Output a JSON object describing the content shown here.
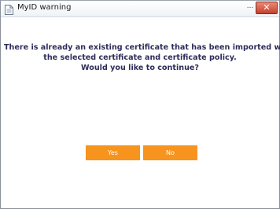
{
  "window": {
    "title": "MyID warning",
    "icon": "document-icon",
    "minimize_label": "...",
    "close_label": "✕",
    "close_color": "#c7402b"
  },
  "dialog": {
    "message_lines": [
      "There is already an existing certificate that has been imported with",
      "the selected certificate and certificate policy.",
      "Would you like to continue?"
    ],
    "message_color": "#2c2c5a",
    "yes_label": "Yes",
    "no_label": "No",
    "button_color": "#f7941d"
  }
}
